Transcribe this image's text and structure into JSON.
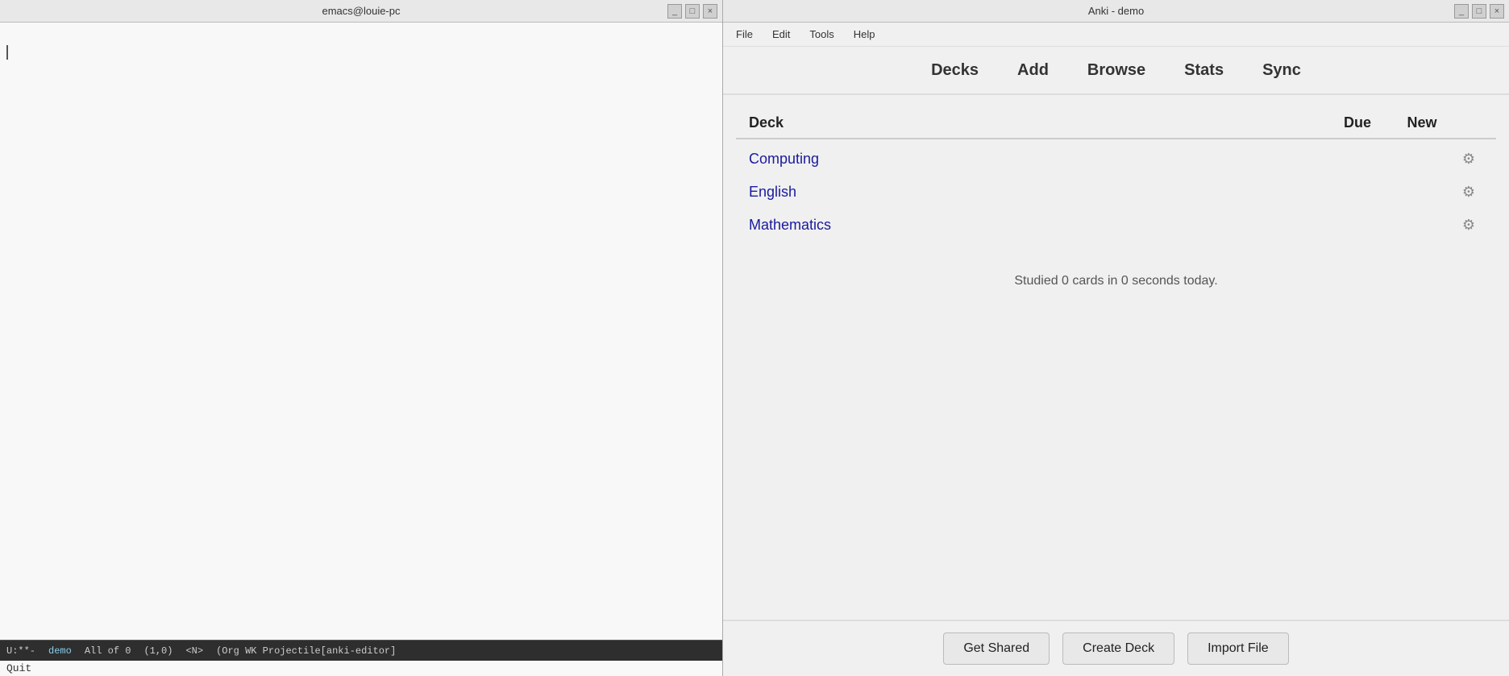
{
  "emacs": {
    "title": "emacs@louie-pc",
    "cursor_position": "",
    "statusbar": {
      "mode": "U:**-",
      "buffer": "demo",
      "position": "All of 0",
      "line_col": "(1,0)",
      "extra": "<N>",
      "minor_modes": "(Org WK Projectile[anki-editor]"
    },
    "quit_label": "Quit",
    "window_controls": [
      "_",
      "□",
      "×"
    ]
  },
  "anki": {
    "title": "Anki - demo",
    "menu": {
      "file": "File",
      "edit": "Edit",
      "tools": "Tools",
      "help": "Help"
    },
    "toolbar": {
      "decks": "Decks",
      "add": "Add",
      "browse": "Browse",
      "stats": "Stats",
      "sync": "Sync"
    },
    "deck_table": {
      "headers": {
        "deck": "Deck",
        "due": "Due",
        "new": "New"
      },
      "rows": [
        {
          "name": "Computing",
          "due": "",
          "new": ""
        },
        {
          "name": "English",
          "due": "",
          "new": ""
        },
        {
          "name": "Mathematics",
          "due": "",
          "new": ""
        }
      ]
    },
    "studied_text": "Studied 0 cards in 0 seconds today.",
    "footer": {
      "get_shared": "Get Shared",
      "create_deck": "Create Deck",
      "import_file": "Import File"
    },
    "window_controls": [
      "_",
      "□",
      "×"
    ]
  }
}
